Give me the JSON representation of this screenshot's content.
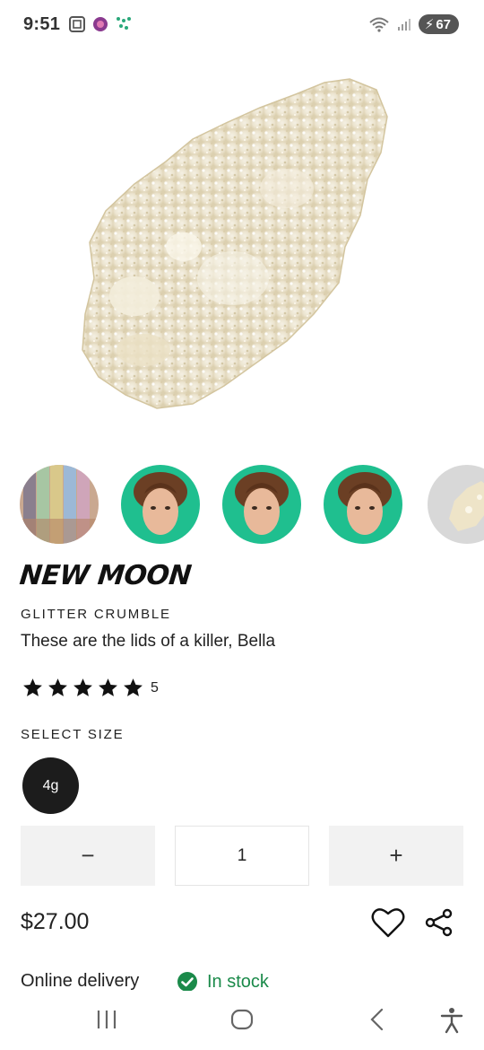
{
  "status_bar": {
    "time": "9:51",
    "battery": "67"
  },
  "product": {
    "name": "NEW MOON",
    "category": "GLITTER CRUMBLE",
    "tagline": "These are the lids of a killer, Bella",
    "rating": {
      "stars": 5,
      "count": "5"
    },
    "size_label": "SELECT SIZE",
    "selected_size": "4g",
    "quantity": "1",
    "decrement_label": "−",
    "increment_label": "+",
    "price": "$27.00",
    "delivery_label": "Online delivery",
    "stock_status": "In stock"
  },
  "thumbnails": [
    {
      "name": "swatch-arm-thumbnail"
    },
    {
      "name": "model-thumbnail-1"
    },
    {
      "name": "model-thumbnail-2"
    },
    {
      "name": "model-thumbnail-3"
    },
    {
      "name": "crumble-thumbnail"
    }
  ],
  "colors": {
    "accent_dark": "#1c1c1c",
    "stock_green": "#1b8a4a",
    "model_bg": "#1fbf8f"
  },
  "icons": {
    "wishlist": "heart-icon",
    "share": "share-icon",
    "stock": "check-circle-icon"
  }
}
